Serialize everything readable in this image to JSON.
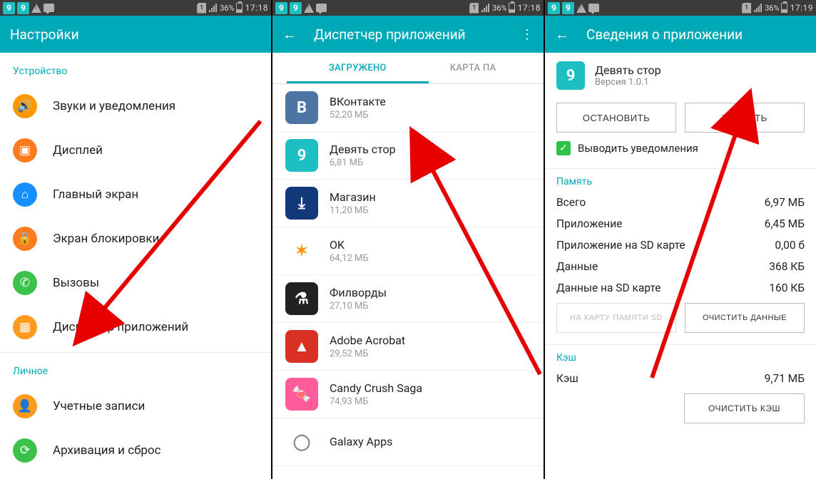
{
  "statusbar": {
    "battery": "36%",
    "time1": "17:18",
    "time2": "17:18",
    "time3": "17:19",
    "sim": "1"
  },
  "screen1": {
    "title": "Настройки",
    "sections": {
      "device": "Устройство",
      "personal": "Личное"
    },
    "items": {
      "sound": "Звуки и уведомления",
      "display": "Дисплей",
      "homescreen": "Главный экран",
      "lockscreen": "Экран блокировки",
      "calls": "Вызовы",
      "appmgr": "Диспетчер приложений",
      "accounts": "Учетные записи",
      "backup": "Архивация и сброс"
    }
  },
  "screen2": {
    "title": "Диспетчер приложений",
    "tabs": {
      "downloaded": "ЗАГРУЖЕНО",
      "sdcard": "КАРТА ПА"
    },
    "apps": [
      {
        "name": "ВКонтакте",
        "size": "52,20 МБ",
        "bg": "#4c75a3",
        "glyph": "B"
      },
      {
        "name": "Девять стор",
        "size": "6,81 МБ",
        "bg": "#1dbfc2",
        "glyph": "9"
      },
      {
        "name": "Магазин",
        "size": "11,20 МБ",
        "bg": "#123a7a",
        "glyph": "⤓"
      },
      {
        "name": "OK",
        "size": "64,12 МБ",
        "bg": "#ffffff",
        "glyph": "✶",
        "fg": "#ff9800"
      },
      {
        "name": "Филворды",
        "size": "27,10 МБ",
        "bg": "#222",
        "glyph": "⚗"
      },
      {
        "name": "Adobe Acrobat",
        "size": "29,52 МБ",
        "bg": "#d93025",
        "glyph": "▲"
      },
      {
        "name": "Candy Crush Saga",
        "size": "74,93 МБ",
        "bg": "#ff5c9b",
        "glyph": "🍬"
      },
      {
        "name": "Galaxy Apps",
        "size": "",
        "bg": "#fff",
        "glyph": "◯",
        "fg": "#888"
      }
    ]
  },
  "screen3": {
    "title": "Сведения о приложении",
    "app": {
      "name": "Девять стор",
      "version": "Версия 1.0.1"
    },
    "buttons": {
      "stop": "ОСТАНОВИТЬ",
      "uninstall": "УДАЛИТЬ",
      "movesd": "НА КАРТУ ПАМЯТИ SD",
      "cleardata": "ОЧИСТИТЬ ДАННЫЕ",
      "clearcache": "ОЧИСТИТЬ КЭШ"
    },
    "notify": "Выводить уведомления",
    "sections": {
      "memory": "Память",
      "cache": "Кэш"
    },
    "rows": {
      "total_l": "Всего",
      "total_v": "6,97 МБ",
      "app_l": "Приложение",
      "app_v": "6,45 МБ",
      "appsd_l": "Приложение на SD карте",
      "appsd_v": "0,00 б",
      "data_l": "Данные",
      "data_v": "368 КБ",
      "datasd_l": "Данные на SD карте",
      "datasd_v": "160 КБ",
      "cache_l": "Кэш",
      "cache_v": "9,71 МБ"
    }
  }
}
